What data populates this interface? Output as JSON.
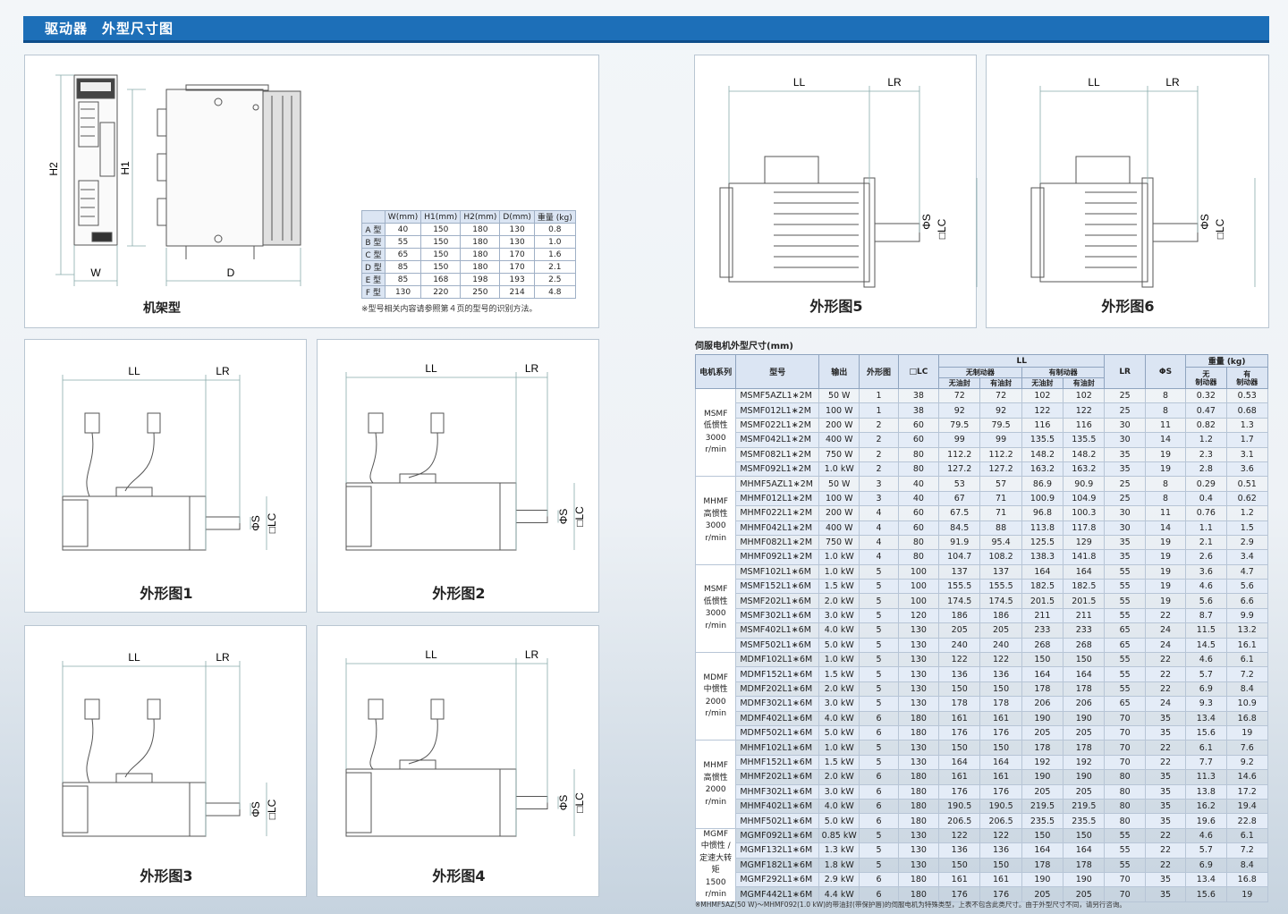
{
  "page": {
    "section_title": "驱动器　外型尺寸图"
  },
  "driver": {
    "dim_labels": {
      "h2": "H2",
      "h1": "H1",
      "w": "W",
      "d": "D"
    },
    "caption": "机架型",
    "table": {
      "headers": [
        "",
        "W(mm)",
        "H1(mm)",
        "H2(mm)",
        "D(mm)",
        "重量 (kg)"
      ],
      "rows": [
        [
          "A 型",
          "40",
          "150",
          "180",
          "130",
          "0.8"
        ],
        [
          "B 型",
          "55",
          "150",
          "180",
          "130",
          "1.0"
        ],
        [
          "C 型",
          "65",
          "150",
          "180",
          "170",
          "1.6"
        ],
        [
          "D 型",
          "85",
          "150",
          "180",
          "170",
          "2.1"
        ],
        [
          "E 型",
          "85",
          "168",
          "198",
          "193",
          "2.5"
        ],
        [
          "F 型",
          "130",
          "220",
          "250",
          "214",
          "4.8"
        ]
      ]
    },
    "note": "※型号相关内容请参照第４页的型号的识别方法。"
  },
  "figures": {
    "fig1": "外形图1",
    "fig2": "外形图2",
    "fig3": "外形图3",
    "fig4": "外形图4",
    "fig5": "外形图5",
    "fig6": "外形图6",
    "labels": {
      "ll": "LL",
      "lr": "LR",
      "s": "ΦS",
      "lc": "□LC"
    }
  },
  "motor_table": {
    "title": "伺服电机外型尺寸(mm)",
    "headers": {
      "series": "电机系列",
      "model": "型号",
      "output": "输出",
      "figure": "外形图",
      "lc": "□LC",
      "ll": "LL",
      "no_brake": "无制动器",
      "with_brake": "有制动器",
      "no_seal": "无油封",
      "with_seal": "有油封",
      "lr": "LR",
      "s": "ΦS",
      "weight": "重量 (kg)",
      "w_no_brake": "无\n制动器",
      "w_with_brake": "有\n制动器"
    },
    "groups": [
      {
        "series": "MSMF\n低惯性\n3000\nr/min",
        "rows": [
          [
            "MSMF5AZL1∗2M",
            "50 W",
            "1",
            "38",
            "72",
            "72",
            "102",
            "102",
            "25",
            "8",
            "0.32",
            "0.53"
          ],
          [
            "MSMF012L1∗2M",
            "100 W",
            "1",
            "38",
            "92",
            "92",
            "122",
            "122",
            "25",
            "8",
            "0.47",
            "0.68"
          ],
          [
            "MSMF022L1∗2M",
            "200 W",
            "2",
            "60",
            "79.5",
            "79.5",
            "116",
            "116",
            "30",
            "11",
            "0.82",
            "1.3"
          ],
          [
            "MSMF042L1∗2M",
            "400 W",
            "2",
            "60",
            "99",
            "99",
            "135.5",
            "135.5",
            "30",
            "14",
            "1.2",
            "1.7"
          ],
          [
            "MSMF082L1∗2M",
            "750 W",
            "2",
            "80",
            "112.2",
            "112.2",
            "148.2",
            "148.2",
            "35",
            "19",
            "2.3",
            "3.1"
          ],
          [
            "MSMF092L1∗2M",
            "1.0 kW",
            "2",
            "80",
            "127.2",
            "127.2",
            "163.2",
            "163.2",
            "35",
            "19",
            "2.8",
            "3.6"
          ]
        ]
      },
      {
        "series": "MHMF\n高惯性\n3000\nr/min",
        "rows": [
          [
            "MHMF5AZL1∗2M",
            "50 W",
            "3",
            "40",
            "53",
            "57",
            "86.9",
            "90.9",
            "25",
            "8",
            "0.29",
            "0.51"
          ],
          [
            "MHMF012L1∗2M",
            "100 W",
            "3",
            "40",
            "67",
            "71",
            "100.9",
            "104.9",
            "25",
            "8",
            "0.4",
            "0.62"
          ],
          [
            "MHMF022L1∗2M",
            "200 W",
            "4",
            "60",
            "67.5",
            "71",
            "96.8",
            "100.3",
            "30",
            "11",
            "0.76",
            "1.2"
          ],
          [
            "MHMF042L1∗2M",
            "400 W",
            "4",
            "60",
            "84.5",
            "88",
            "113.8",
            "117.8",
            "30",
            "14",
            "1.1",
            "1.5"
          ],
          [
            "MHMF082L1∗2M",
            "750 W",
            "4",
            "80",
            "91.9",
            "95.4",
            "125.5",
            "129",
            "35",
            "19",
            "2.1",
            "2.9"
          ],
          [
            "MHMF092L1∗2M",
            "1.0 kW",
            "4",
            "80",
            "104.7",
            "108.2",
            "138.3",
            "141.8",
            "35",
            "19",
            "2.6",
            "3.4"
          ]
        ]
      },
      {
        "series": "MSMF\n低惯性\n3000\nr/min",
        "rows": [
          [
            "MSMF102L1∗6M",
            "1.0 kW",
            "5",
            "100",
            "137",
            "137",
            "164",
            "164",
            "55",
            "19",
            "3.6",
            "4.7"
          ],
          [
            "MSMF152L1∗6M",
            "1.5 kW",
            "5",
            "100",
            "155.5",
            "155.5",
            "182.5",
            "182.5",
            "55",
            "19",
            "4.6",
            "5.6"
          ],
          [
            "MSMF202L1∗6M",
            "2.0 kW",
            "5",
            "100",
            "174.5",
            "174.5",
            "201.5",
            "201.5",
            "55",
            "19",
            "5.6",
            "6.6"
          ],
          [
            "MSMF302L1∗6M",
            "3.0 kW",
            "5",
            "120",
            "186",
            "186",
            "211",
            "211",
            "55",
            "22",
            "8.7",
            "9.9"
          ],
          [
            "MSMF402L1∗6M",
            "4.0 kW",
            "5",
            "130",
            "205",
            "205",
            "233",
            "233",
            "65",
            "24",
            "11.5",
            "13.2"
          ],
          [
            "MSMF502L1∗6M",
            "5.0 kW",
            "5",
            "130",
            "240",
            "240",
            "268",
            "268",
            "65",
            "24",
            "14.5",
            "16.1"
          ]
        ]
      },
      {
        "series": "MDMF\n中惯性\n2000\nr/min",
        "rows": [
          [
            "MDMF102L1∗6M",
            "1.0 kW",
            "5",
            "130",
            "122",
            "122",
            "150",
            "150",
            "55",
            "22",
            "4.6",
            "6.1"
          ],
          [
            "MDMF152L1∗6M",
            "1.5 kW",
            "5",
            "130",
            "136",
            "136",
            "164",
            "164",
            "55",
            "22",
            "5.7",
            "7.2"
          ],
          [
            "MDMF202L1∗6M",
            "2.0 kW",
            "5",
            "130",
            "150",
            "150",
            "178",
            "178",
            "55",
            "22",
            "6.9",
            "8.4"
          ],
          [
            "MDMF302L1∗6M",
            "3.0 kW",
            "5",
            "130",
            "178",
            "178",
            "206",
            "206",
            "65",
            "24",
            "9.3",
            "10.9"
          ],
          [
            "MDMF402L1∗6M",
            "4.0 kW",
            "6",
            "180",
            "161",
            "161",
            "190",
            "190",
            "70",
            "35",
            "13.4",
            "16.8"
          ],
          [
            "MDMF502L1∗6M",
            "5.0 kW",
            "6",
            "180",
            "176",
            "176",
            "205",
            "205",
            "70",
            "35",
            "15.6",
            "19"
          ]
        ]
      },
      {
        "series": "MHMF\n高惯性\n2000\nr/min",
        "rows": [
          [
            "MHMF102L1∗6M",
            "1.0 kW",
            "5",
            "130",
            "150",
            "150",
            "178",
            "178",
            "70",
            "22",
            "6.1",
            "7.6"
          ],
          [
            "MHMF152L1∗6M",
            "1.5 kW",
            "5",
            "130",
            "164",
            "164",
            "192",
            "192",
            "70",
            "22",
            "7.7",
            "9.2"
          ],
          [
            "MHMF202L1∗6M",
            "2.0 kW",
            "6",
            "180",
            "161",
            "161",
            "190",
            "190",
            "80",
            "35",
            "11.3",
            "14.6"
          ],
          [
            "MHMF302L1∗6M",
            "3.0 kW",
            "6",
            "180",
            "176",
            "176",
            "205",
            "205",
            "80",
            "35",
            "13.8",
            "17.2"
          ],
          [
            "MHMF402L1∗6M",
            "4.0 kW",
            "6",
            "180",
            "190.5",
            "190.5",
            "219.5",
            "219.5",
            "80",
            "35",
            "16.2",
            "19.4"
          ],
          [
            "MHMF502L1∗6M",
            "5.0 kW",
            "6",
            "180",
            "206.5",
            "206.5",
            "235.5",
            "235.5",
            "80",
            "35",
            "19.6",
            "22.8"
          ]
        ]
      },
      {
        "series": "MGMF\n中惯性 /\n定速大转矩\n1500\nr/min",
        "rows": [
          [
            "MGMF092L1∗6M",
            "0.85 kW",
            "5",
            "130",
            "122",
            "122",
            "150",
            "150",
            "55",
            "22",
            "4.6",
            "6.1"
          ],
          [
            "MGMF132L1∗6M",
            "1.3 kW",
            "5",
            "130",
            "136",
            "136",
            "164",
            "164",
            "55",
            "22",
            "5.7",
            "7.2"
          ],
          [
            "MGMF182L1∗6M",
            "1.8 kW",
            "5",
            "130",
            "150",
            "150",
            "178",
            "178",
            "55",
            "22",
            "6.9",
            "8.4"
          ],
          [
            "MGMF292L1∗6M",
            "2.9 kW",
            "6",
            "180",
            "161",
            "161",
            "190",
            "190",
            "70",
            "35",
            "13.4",
            "16.8"
          ],
          [
            "MGMF442L1∗6M",
            "4.4 kW",
            "6",
            "180",
            "176",
            "176",
            "205",
            "205",
            "70",
            "35",
            "15.6",
            "19"
          ]
        ]
      }
    ],
    "footnote": "※MHMF5AZ(50 W)～MHMF092(1.0 kW)的带油封(带保护唇)的伺服电机为特殊类型，上表不包含此类尺寸。由于外型尺寸不同，请另行咨询。"
  }
}
